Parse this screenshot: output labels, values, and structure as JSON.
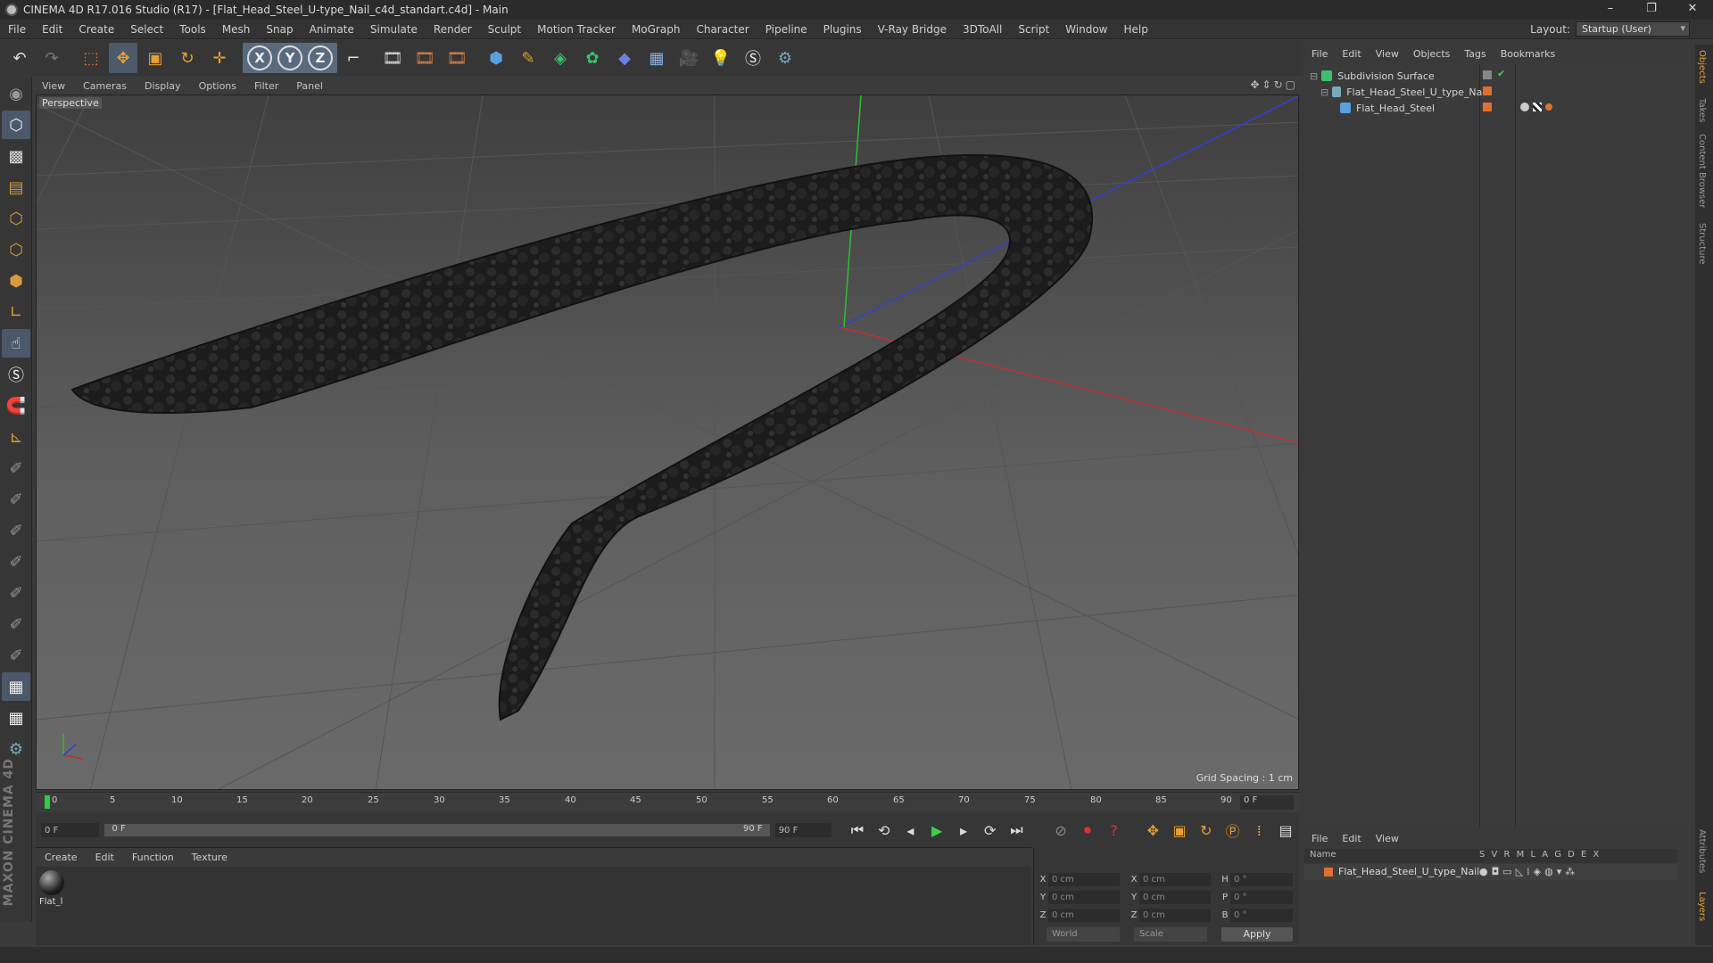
{
  "window": {
    "title": "CINEMA 4D R17.016 Studio (R17) - [Flat_Head_Steel_U-type_Nail_c4d_standart.c4d] - Main",
    "controls": [
      "–",
      "❐",
      "✕"
    ]
  },
  "menubar": {
    "items": [
      "File",
      "Edit",
      "Create",
      "Select",
      "Tools",
      "Mesh",
      "Snap",
      "Animate",
      "Simulate",
      "Render",
      "Sculpt",
      "Motion Tracker",
      "MoGraph",
      "Character",
      "Pipeline",
      "Plugins",
      "V-Ray Bridge",
      "3DToAll",
      "Script",
      "Window",
      "Help"
    ],
    "layout_label": "Layout:",
    "layout_value": "Startup (User)"
  },
  "toolbar": {
    "axis_x": "X",
    "axis_y": "Y",
    "axis_z": "Z"
  },
  "viewport": {
    "menu": [
      "View",
      "Cameras",
      "Display",
      "Options",
      "Filter",
      "Panel"
    ],
    "label": "Perspective",
    "grid_spacing": "Grid Spacing : 1 cm",
    "colors": {
      "x_axis": "#c03030",
      "y_axis": "#2fbf2f",
      "z_axis": "#3040d0"
    }
  },
  "timeline": {
    "ticks": [
      "0",
      "5",
      "10",
      "15",
      "20",
      "25",
      "30",
      "35",
      "40",
      "45",
      "50",
      "55",
      "60",
      "65",
      "70",
      "75",
      "80",
      "85",
      "90"
    ],
    "current_frame": "0 F"
  },
  "transport": {
    "start_field": "0 F",
    "slider_start": "0 F",
    "slider_end": "90 F",
    "end_field": "90 F"
  },
  "material_manager": {
    "menu": [
      "Create",
      "Edit",
      "Function",
      "Texture"
    ],
    "material_name": "Flat_l"
  },
  "coordinates": {
    "rows": [
      {
        "l1": "X",
        "v1": "0 cm",
        "l2": "X",
        "v2": "0 cm",
        "l3": "H",
        "v3": "0 °"
      },
      {
        "l1": "Y",
        "v1": "0 cm",
        "l2": "Y",
        "v2": "0 cm",
        "l3": "P",
        "v3": "0 °"
      },
      {
        "l1": "Z",
        "v1": "0 cm",
        "l2": "Z",
        "v2": "0 cm",
        "l3": "B",
        "v3": "0 °"
      }
    ],
    "world": "World",
    "scale": "Scale",
    "apply": "Apply"
  },
  "object_manager": {
    "menu": [
      "File",
      "Edit",
      "View",
      "Objects",
      "Tags",
      "Bookmarks"
    ],
    "objects": [
      {
        "name": "Subdivision Surface"
      },
      {
        "name": "Flat_Head_Steel_U_type_Nail"
      },
      {
        "name": "Flat_Head_Steel"
      }
    ]
  },
  "side_tabs": [
    "Objects",
    "Takes",
    "Content Browser",
    "Structure",
    "Attributes",
    "Layers"
  ],
  "layer_manager": {
    "menu": [
      "File",
      "Edit",
      "View"
    ],
    "header_name": "Name",
    "header_cols": "S V R M L A G D E X",
    "row_name": "Flat_Head_Steel_U_type_Nail"
  },
  "brand": "MAXON CINEMA 4D"
}
